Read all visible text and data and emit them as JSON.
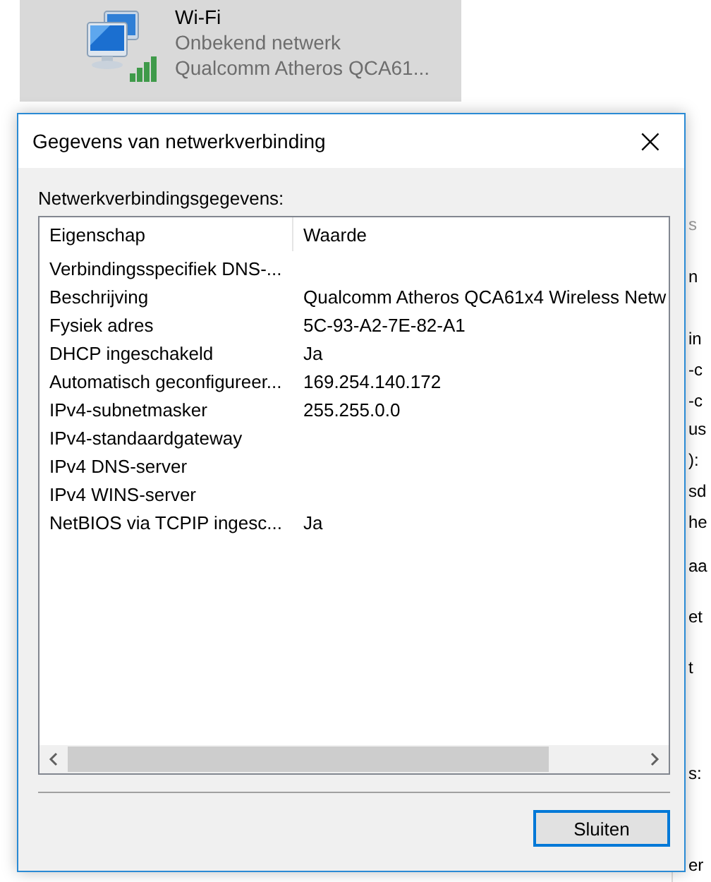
{
  "network_tile": {
    "name": "Wi-Fi",
    "status": "Onbekend netwerk",
    "adapter": "Qualcomm Atheros QCA61..."
  },
  "dialog": {
    "title": "Gegevens van netwerkverbinding",
    "close": "×",
    "section_label": "Netwerkverbindingsgegevens:",
    "table": {
      "columns": [
        "Eigenschap",
        "Waarde"
      ],
      "rows": [
        {
          "property": "Verbindingsspecifiek DNS-...",
          "value": ""
        },
        {
          "property": "Beschrijving",
          "value": "Qualcomm Atheros QCA61x4 Wireless Netw"
        },
        {
          "property": "Fysiek adres",
          "value": "5C-93-A2-7E-82-A1"
        },
        {
          "property": "DHCP ingeschakeld",
          "value": "Ja"
        },
        {
          "property": "Automatisch geconfigureer...",
          "value": "169.254.140.172"
        },
        {
          "property": "IPv4-subnetmasker",
          "value": "255.255.0.0"
        },
        {
          "property": "IPv4-standaardgateway",
          "value": ""
        },
        {
          "property": "IPv4 DNS-server",
          "value": ""
        },
        {
          "property": "IPv4 WINS-server",
          "value": ""
        },
        {
          "property": "NetBIOS via TCPIP ingesc...",
          "value": "Ja"
        }
      ]
    },
    "buttons": [
      "Sluiten"
    ]
  },
  "background_window": {
    "fragments": [
      "s",
      "n",
      "in",
      "-c",
      "-c",
      "us",
      "):",
      "sd",
      "he",
      "aa",
      "et",
      "t",
      "s:",
      "er"
    ]
  }
}
